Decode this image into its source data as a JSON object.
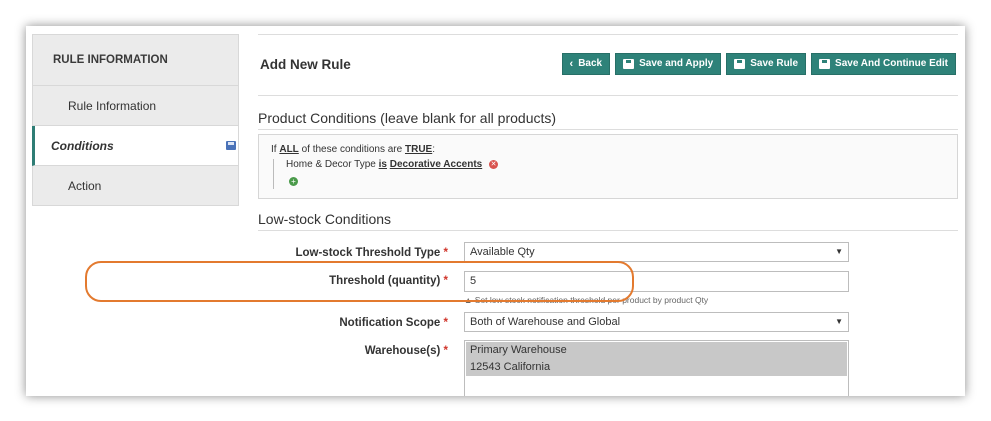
{
  "sidebar": {
    "header": "RULE INFORMATION",
    "items": [
      {
        "label": "Rule Information"
      },
      {
        "label": "Conditions"
      },
      {
        "label": "Action"
      }
    ]
  },
  "header": {
    "title": "Add New Rule",
    "buttons": {
      "back": "Back",
      "save_apply": "Save and Apply",
      "save_rule": "Save Rule",
      "save_continue": "Save And Continue Edit"
    }
  },
  "product_conditions": {
    "title": "Product Conditions (leave blank for all products)",
    "prefix": "If",
    "aggregator": "ALL",
    "middle": "of these conditions are",
    "value": "TRUE",
    "suffix": ":",
    "condition": {
      "attribute": "Home & Decor Type",
      "operator": "is",
      "value": "Decorative Accents"
    }
  },
  "low_stock": {
    "title": "Low-stock Conditions",
    "threshold_type": {
      "label": "Low-stock Threshold Type",
      "value": "Available Qty"
    },
    "threshold_qty": {
      "label": "Threshold (quantity)",
      "value": "5",
      "hint": "Set low stock notification threshold per product by product Qty"
    },
    "notification_scope": {
      "label": "Notification Scope",
      "value": "Both of Warehouse and Global"
    },
    "warehouses": {
      "label": "Warehouse(s)",
      "options": [
        "Primary Warehouse",
        "12543 California"
      ]
    },
    "required_mark": "*"
  },
  "colors": {
    "accent": "#2e8279",
    "highlight": "#e37a2f",
    "required": "#d0352b"
  }
}
